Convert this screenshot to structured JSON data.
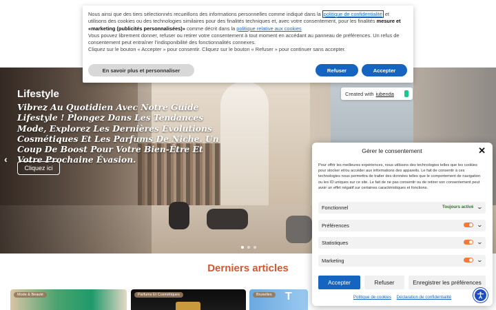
{
  "banner": {
    "text_1": "Nous ainsi que des tiers sélectionnés recueillons des informations personnelles comme indiqué dans la",
    "link_privacy": "politique de confidentialité",
    "text_2": "et utilisons des cookies ou des technologies similaires pour des finalités techniques et, avec votre consentement, pour les finalités",
    "text_bold": "mesure et «marketing (publicités personnalisées)»",
    "text_3": "comme décrit dans la",
    "link_cookies": "politique relative aux cookies",
    "text_4": "Vous pouvez librement donner, refuser ou retirer votre consentement à tout moment en accédant au panneau de préférences. Un refus de consentement peut entraîner l’indisponibilité des fonctionnalités connexes.",
    "text_5": "Cliquez sur le bouton « Accepter » pour consentir. Cliquez sur le bouton « Refuser » pour continuer sans accepter.",
    "learn_more": "En savoir plus et personnaliser",
    "refuse": "Refuser",
    "accept": "Accepter",
    "created_with": "Created with",
    "created_brand": "iubenda"
  },
  "hero": {
    "title": "Lifestyle",
    "text": "Vibrez Au Quotidien Avec Notre Guide Lifestyle ! Plongez Dans Les Tendances Mode, Explorez Les Dernières Évolutions Cosmétiques Et Les Parfums De Niche. Un Coup De Boost Pour Votre Bien-Être Et Votre Prochaine Évasion.",
    "button": "Cliquez ici",
    "prev_arrow": "‹"
  },
  "section": {
    "title": "Derniers articles"
  },
  "cards": [
    {
      "tag": "Mode & Beauté"
    },
    {
      "tag": "Parfums Et Cosmétiques"
    },
    {
      "tag": "Bruxelles",
      "snippet": "T"
    }
  ],
  "modal": {
    "title": "Gérer le consentement",
    "close": "✕",
    "description": "Pour offrir les meilleures expériences, nous utilisons des technologies telles que les cookies pour stocker et/ou accéder aux informations des appareils. Le fait de consentir à ces technologies nous permettra de traiter des données telles que le comportement de navigation ou les ID uniques sur ce site. Le fait de ne pas consentir ou de retirer son consentement peut avoir un effet négatif sur certaines caractéristiques et fonctions.",
    "rows": [
      {
        "label": "Fonctionnel",
        "status": "Toujours activé"
      },
      {
        "label": "Préférences"
      },
      {
        "label": "Statistiques"
      },
      {
        "label": "Marketing"
      }
    ],
    "accept": "Accepter",
    "refuse": "Refuser",
    "save": "Enregistrer les préférences",
    "link_cookies": "Politique de cookies",
    "link_privacy": "Déclaration de confidentialité"
  },
  "colors": {
    "accent_blue": "#1565c0",
    "section_title": "#d2562e",
    "toggle_orange": "#f07a3a"
  },
  "icons": {
    "close": "close-icon",
    "chevron": "chevron-down-icon",
    "accessibility": "accessibility-icon",
    "slider_prev": "chevron-left-icon"
  }
}
